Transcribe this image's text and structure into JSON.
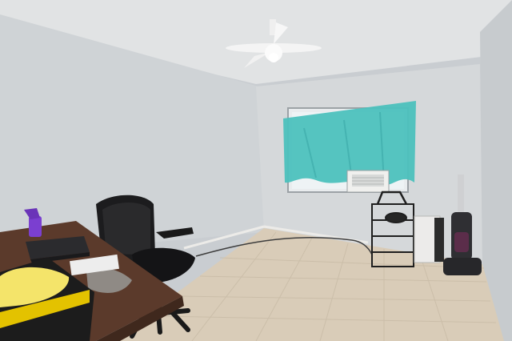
{
  "scene": {
    "description_type": "photo-interior",
    "objects": [
      "ceiling-fan",
      "window",
      "teal-curtain",
      "wall-air-conditioner",
      "desk",
      "office-chair",
      "spray-bottle",
      "laptop",
      "yellow-cloth",
      "shoe-rack",
      "upright-vacuum",
      "floor-tiles"
    ]
  },
  "colors": {
    "wall": "#d2d6d9",
    "ceiling": "#dfe2e4",
    "floor": "#d8cbb7",
    "curtain": "#4fc3c0",
    "desk": "#5a3a2a",
    "chair": "#1d1d1f",
    "spray": "#7b3fd0",
    "cloth": "#f3e46a"
  }
}
